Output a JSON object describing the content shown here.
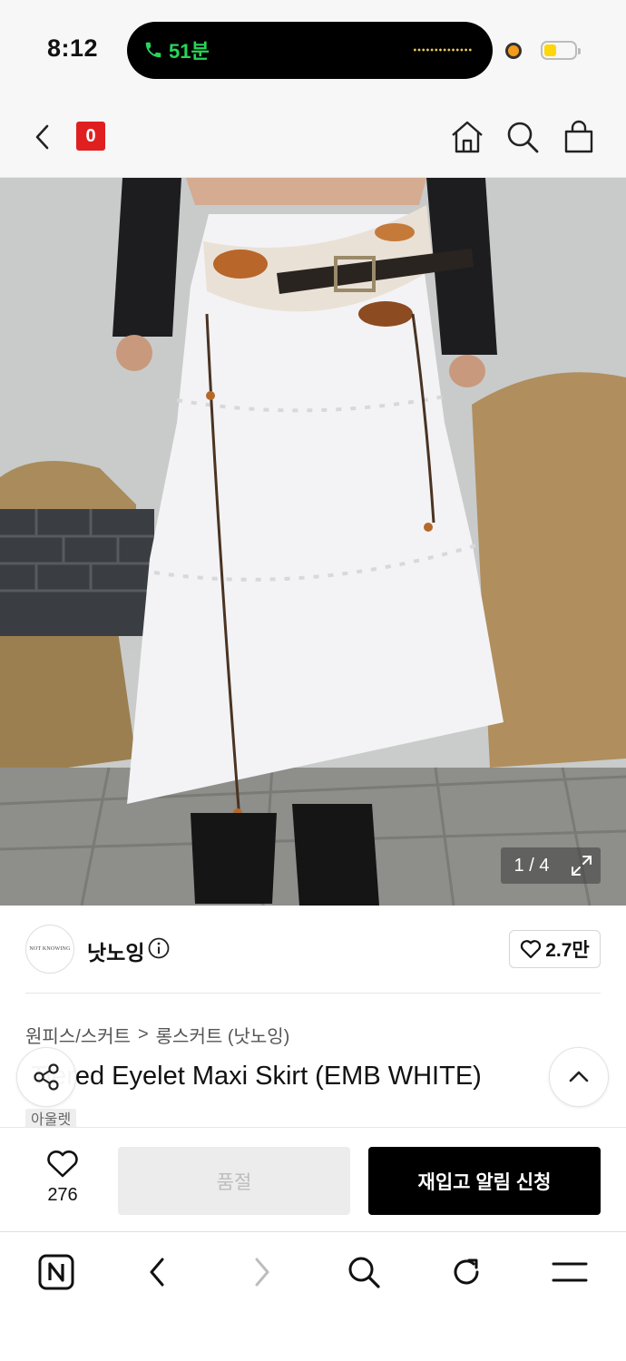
{
  "status": {
    "time": "8:12",
    "call_duration": "51분"
  },
  "nav": {
    "cart_count": "0"
  },
  "gallery": {
    "counter": "1 / 4"
  },
  "brand": {
    "logo_text": "NOT KNOWING",
    "name": "낫노잉",
    "likes": "2.7만"
  },
  "breadcrumb": {
    "category": "원피스/스커트",
    "separator": ">",
    "subcategory": "롱스커트 (낫노잉)"
  },
  "product": {
    "title": "Tiered Eyelet Maxi Skirt (EMB WHITE)",
    "tag": "아울렛"
  },
  "buybar": {
    "wish_count": "276",
    "soldout_label": "품절",
    "restock_label": "재입고 알림 신청"
  },
  "colors": {
    "badge": "#e02020",
    "call_green": "#28d45a",
    "primary": "#000000",
    "disabled": "#ececec"
  }
}
